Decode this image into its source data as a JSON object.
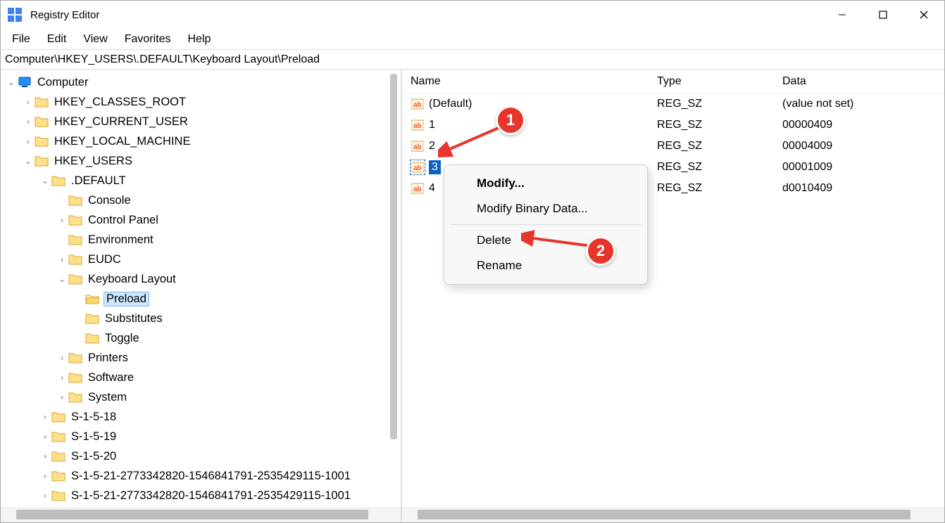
{
  "window": {
    "title": "Registry Editor"
  },
  "menu": {
    "file": "File",
    "edit": "Edit",
    "view": "View",
    "favorites": "Favorites",
    "help": "Help"
  },
  "address": "Computer\\HKEY_USERS\\.DEFAULT\\Keyboard Layout\\Preload",
  "tree": {
    "root": "Computer",
    "hkcr": "HKEY_CLASSES_ROOT",
    "hkcu": "HKEY_CURRENT_USER",
    "hklm": "HKEY_LOCAL_MACHINE",
    "hku": "HKEY_USERS",
    "default": ".DEFAULT",
    "console": "Console",
    "controlpanel": "Control Panel",
    "environment": "Environment",
    "eudc": "EUDC",
    "keyboardlayout": "Keyboard Layout",
    "preload": "Preload",
    "substitutes": "Substitutes",
    "toggle": "Toggle",
    "printers": "Printers",
    "software": "Software",
    "system": "System",
    "s1518": "S-1-5-18",
    "s1519": "S-1-5-19",
    "s1520": "S-1-5-20",
    "s1521a": "S-1-5-21-2773342820-1546841791-2535429115-1001",
    "s1521b": "S-1-5-21-2773342820-1546841791-2535429115-1001"
  },
  "list": {
    "headers": {
      "name": "Name",
      "type": "Type",
      "data": "Data"
    },
    "rows": [
      {
        "name": "(Default)",
        "type": "REG_SZ",
        "data": "(value not set)"
      },
      {
        "name": "1",
        "type": "REG_SZ",
        "data": "00000409"
      },
      {
        "name": "2",
        "type": "REG_SZ",
        "data": "00004009"
      },
      {
        "name": "3",
        "type": "REG_SZ",
        "data": "00001009"
      },
      {
        "name": "4",
        "type": "REG_SZ",
        "data": "d0010409"
      }
    ]
  },
  "context_menu": {
    "modify": "Modify...",
    "modify_binary": "Modify Binary Data...",
    "delete": "Delete",
    "rename": "Rename"
  },
  "annotations": {
    "step1": "1",
    "step2": "2"
  }
}
